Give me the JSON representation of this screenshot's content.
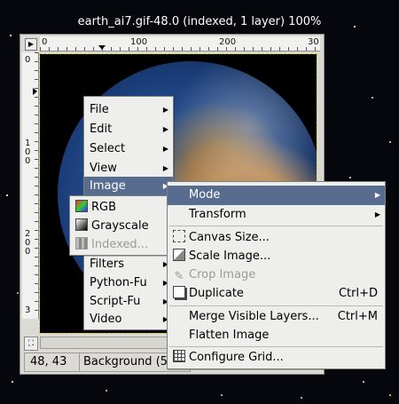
{
  "window": {
    "title": "earth_ai7.gif-48.0 (indexed, 1 layer) 100%"
  },
  "rulers": {
    "h_ticks": [
      "0",
      "100",
      "200",
      "30"
    ],
    "v_ticks": [
      "0",
      "1\n0\n0",
      "2\n0\n0",
      "3"
    ]
  },
  "status": {
    "coords": "48, 43",
    "layer": "Background (5"
  },
  "main_menu": {
    "items": [
      {
        "label": "File",
        "submenu": true
      },
      {
        "label": "Edit",
        "submenu": true
      },
      {
        "label": "Select",
        "submenu": true
      },
      {
        "label": "View",
        "submenu": true
      },
      {
        "label": "Image",
        "submenu": true,
        "highlighted": true
      },
      {
        "label": "Filters",
        "submenu": true
      },
      {
        "label": "Python-Fu",
        "submenu": true
      },
      {
        "label": "Script-Fu",
        "submenu": true
      },
      {
        "label": "Video",
        "submenu": true
      }
    ]
  },
  "mode_menu": {
    "items": [
      {
        "label": "RGB",
        "icon": "rgb-icon"
      },
      {
        "label": "Grayscale",
        "icon": "grayscale-icon"
      },
      {
        "label": "Indexed...",
        "icon": "indexed-icon",
        "disabled": true
      }
    ]
  },
  "image_menu": {
    "items": [
      {
        "label": "Mode",
        "submenu": true,
        "highlighted": true
      },
      {
        "label": "Transform",
        "submenu": true
      },
      {
        "label": "Canvas Size...",
        "icon": "canvas-size-icon"
      },
      {
        "label": "Scale Image...",
        "icon": "scale-image-icon"
      },
      {
        "label": "Crop Image",
        "icon": "crop-icon",
        "disabled": true
      },
      {
        "label": "Duplicate",
        "icon": "duplicate-icon",
        "shortcut": "Ctrl+D"
      },
      {
        "label": "Merge Visible Layers...",
        "shortcut": "Ctrl+M"
      },
      {
        "label": "Flatten Image"
      },
      {
        "label": "Configure Grid...",
        "icon": "grid-icon"
      }
    ]
  },
  "colors": {
    "menu_highlight": "#576c8f",
    "guide": "#e2d300"
  }
}
